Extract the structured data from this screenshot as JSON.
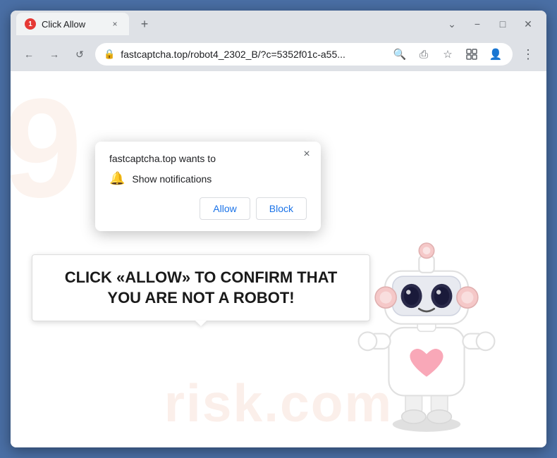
{
  "browser": {
    "tab": {
      "favicon_number": "1",
      "title": "Click Allow",
      "close_label": "×"
    },
    "new_tab_label": "+",
    "window_controls": {
      "minimize": "−",
      "maximize": "□",
      "close": "✕"
    },
    "nav": {
      "back": "←",
      "forward": "→",
      "reload": "↺"
    },
    "url": {
      "display": "fastcaptcha.top/robot4_2302_B/?c=5352f01c-a55...",
      "lock_icon": "🔒"
    },
    "toolbar_icons": {
      "search": "🔍",
      "share": "⎙",
      "star": "☆",
      "extension": "□",
      "profile": "👤",
      "menu": "⋮"
    }
  },
  "permission_popup": {
    "title": "fastcaptcha.top wants to",
    "close_label": "×",
    "notification_label": "Show notifications",
    "allow_button": "Allow",
    "block_button": "Block"
  },
  "page": {
    "captcha_text": "CLICK «ALLOW» TO CONFIRM THAT YOU ARE NOT A ROBOT!",
    "watermark_text": "risk.com",
    "watermark_9": "9"
  }
}
